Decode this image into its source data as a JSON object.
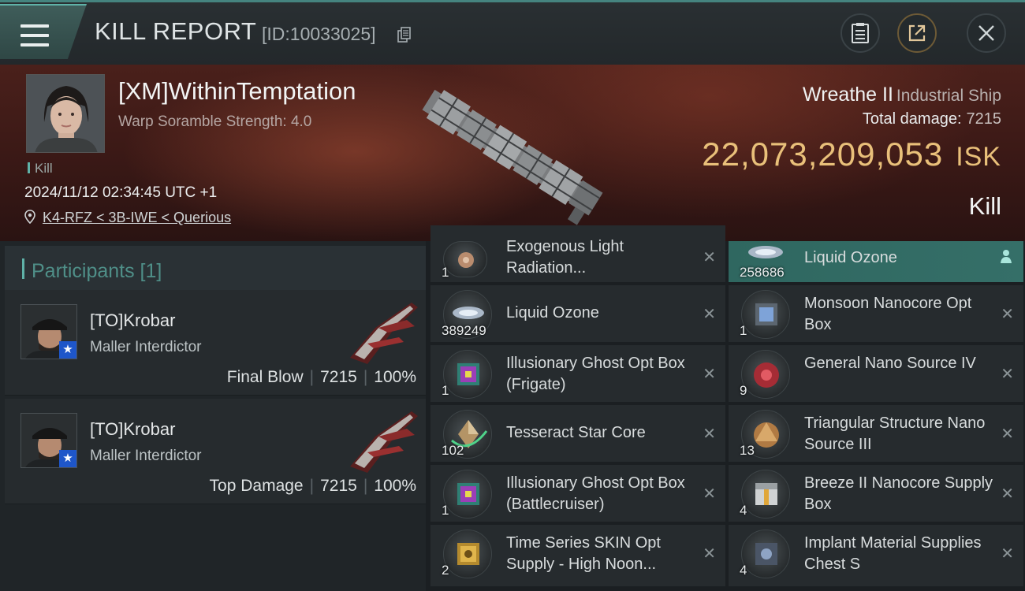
{
  "header": {
    "title": "KILL REPORT",
    "report_id": "[ID:10033025]"
  },
  "victim": {
    "name": "[XM]WithinTemptation",
    "warp_scramble": "Warp Soramble Strength: 4.0",
    "kill_tag": "Kill",
    "datetime": "2024/11/12 02:34:45 UTC +1",
    "location": "K4-RFZ < 3B-IWE < Querious",
    "ship_name": "Wreathe II",
    "ship_class": "Industrial Ship",
    "total_damage_label": "Total damage:",
    "total_damage": "7215",
    "isk_value": "22,073,209,053",
    "isk_unit": "ISK",
    "result": "Kill"
  },
  "participants": {
    "header": "Participants [1]",
    "rows": [
      {
        "name": "[TO]Krobar",
        "ship": "Maller Interdictor",
        "role": "Final Blow",
        "damage": "7215",
        "percent": "100%"
      },
      {
        "name": "[TO]Krobar",
        "ship": "Maller Interdictor",
        "role": "Top Damage",
        "damage": "7215",
        "percent": "100%"
      }
    ]
  },
  "items": {
    "left": [
      {
        "name": "Exogenous Light Radiation...",
        "qty": "1",
        "icon": "radiation-module-icon"
      },
      {
        "name": "Liquid Ozone",
        "qty": "389249",
        "icon": "liquid-ozone-icon"
      },
      {
        "name": "Illusionary Ghost Opt Box (Frigate)",
        "qty": "1",
        "icon": "opt-box-icon"
      },
      {
        "name": "Tesseract Star Core",
        "qty": "102",
        "icon": "star-core-icon"
      },
      {
        "name": "Illusionary Ghost Opt Box (Battlecruiser)",
        "qty": "1",
        "icon": "opt-box-icon"
      },
      {
        "name": "Time Series SKIN Opt Supply - High Noon...",
        "qty": "2",
        "icon": "skin-box-icon"
      }
    ],
    "right": [
      {
        "name": "Liquid Ozone",
        "qty": "258686",
        "icon": "liquid-ozone-icon",
        "active": true
      },
      {
        "name": "Monsoon Nanocore Opt Box",
        "qty": "1",
        "icon": "nanocore-box-icon"
      },
      {
        "name": "General Nano Source IV",
        "qty": "9",
        "icon": "nano-source-icon"
      },
      {
        "name": "Triangular Structure Nano Source III",
        "qty": "13",
        "icon": "nano-source-icon"
      },
      {
        "name": "Breeze II Nanocore Supply Box",
        "qty": "4",
        "icon": "supply-box-icon"
      },
      {
        "name": "Implant Material Supplies Chest S",
        "qty": "4",
        "icon": "chest-icon"
      }
    ],
    "dropped_mark": "✕"
  },
  "colors": {
    "accent": "#5fb2a8",
    "isk_gold": "#e9c07a",
    "hero_red": "#4a201b",
    "corp_badge": "#1e56c9"
  }
}
